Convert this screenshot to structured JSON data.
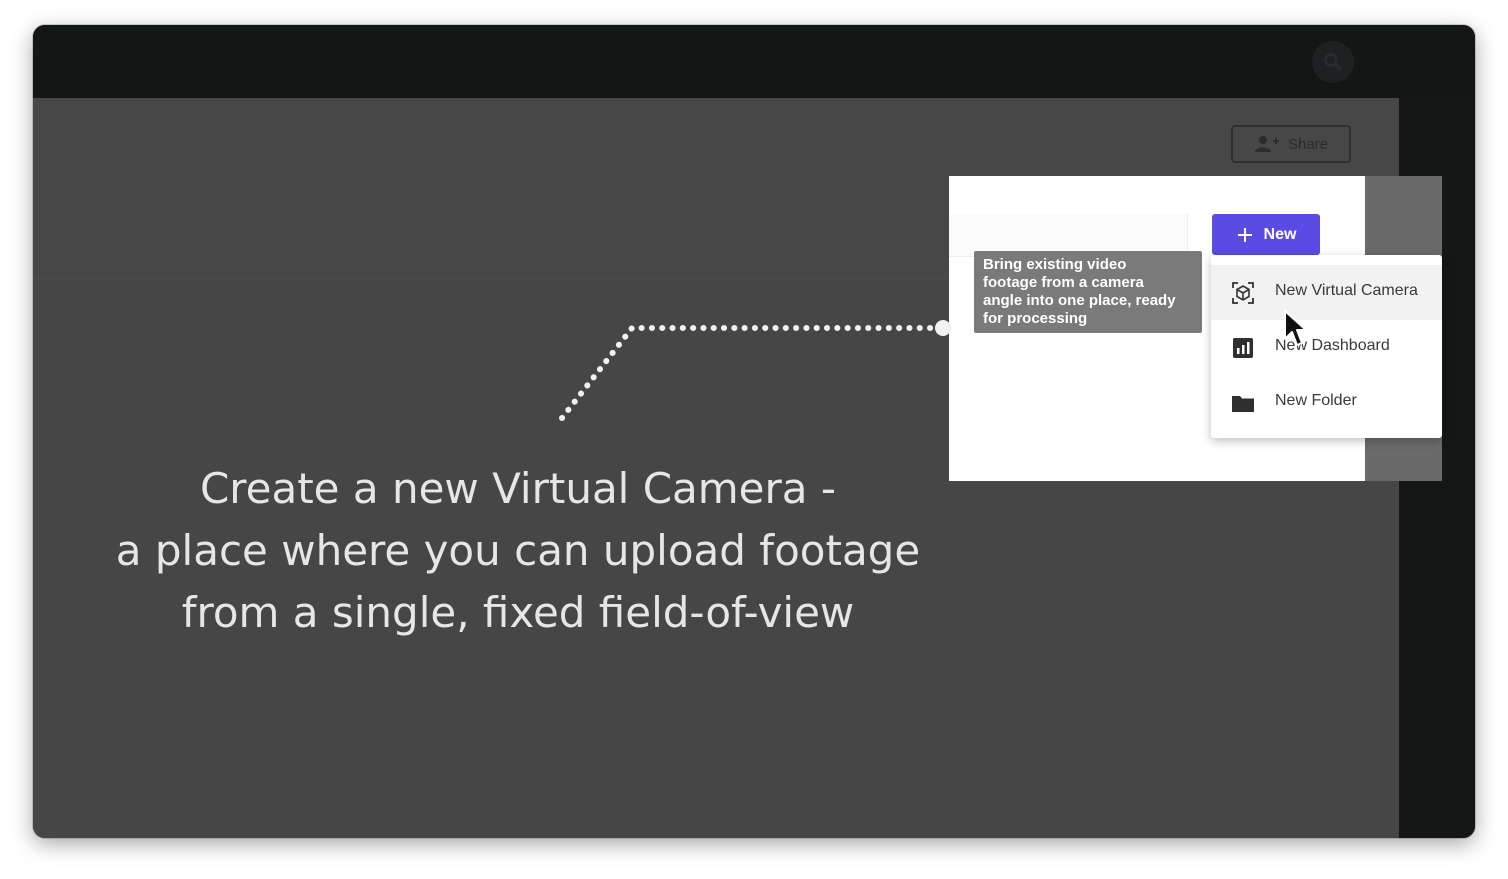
{
  "header": {
    "share_label": "Share"
  },
  "toolbar": {
    "new_label": "New"
  },
  "tooltip": {
    "text": "Bring existing video\nfootage from a camera\nangle into one place, ready\nfor processing"
  },
  "menu": {
    "items": [
      {
        "label": "New Virtual Camera",
        "icon": "virtual-camera-icon"
      },
      {
        "label": "New Dashboard",
        "icon": "dashboard-icon"
      },
      {
        "label": "New Folder",
        "icon": "folder-icon"
      }
    ]
  },
  "caption": {
    "line1": "Create a new Virtual Camera -",
    "line2": "a place where you can upload footage",
    "line3": "from a single, fixed field-of-view"
  },
  "colors": {
    "accent": "#5a4be3",
    "overlay": "#464646",
    "caption_text": "#e6e6e6"
  }
}
